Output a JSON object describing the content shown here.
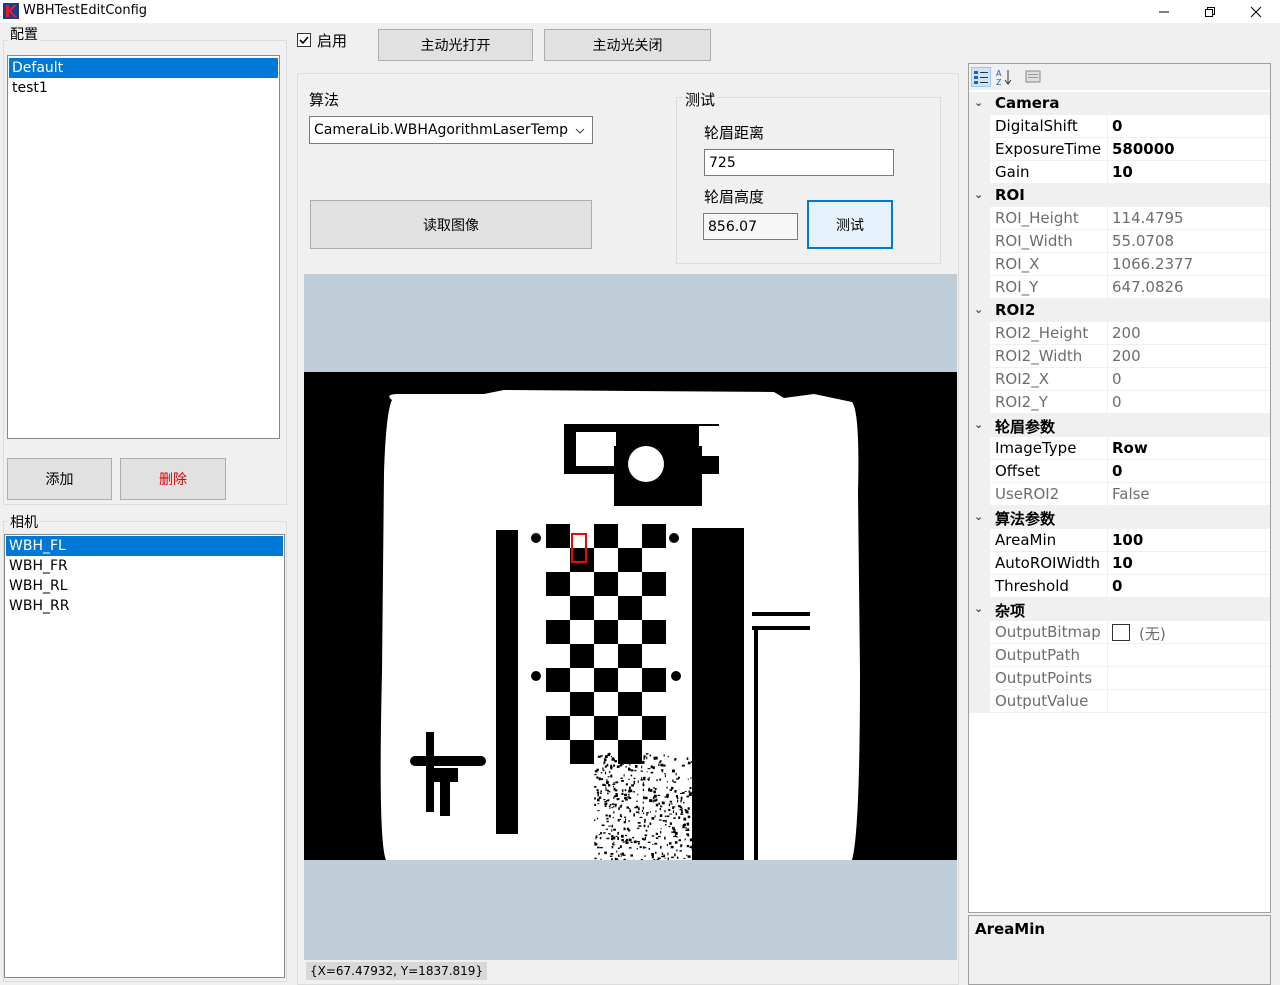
{
  "window": {
    "title": "WBHTestEditConfig"
  },
  "config_group": {
    "title": "配置",
    "items": [
      "Default",
      "test1"
    ],
    "selected": 0
  },
  "buttons": {
    "add": "添加",
    "delete": "删除",
    "light_on": "主动光打开",
    "light_off": "主动光关闭",
    "read_image": "读取图像",
    "test": "测试"
  },
  "enable_checkbox": {
    "label": "启用",
    "checked": true
  },
  "camera_group": {
    "title": "相机",
    "items": [
      "WBH_FL",
      "WBH_FR",
      "WBH_RL",
      "WBH_RR"
    ],
    "selected": 0
  },
  "algorithm": {
    "label": "算法",
    "selected": "CameraLib.WBHAgorithmLaserTemp"
  },
  "test_group": {
    "title": "测试",
    "distance_label": "轮眉距离",
    "distance_value": "725",
    "height_label": "轮眉高度",
    "height_value": "856.07"
  },
  "image_view": {
    "coord_readout": "{X=67.47932, Y=1837.819}"
  },
  "property_grid": {
    "categories": [
      {
        "name": "Camera",
        "props": [
          {
            "name": "DigitalShift",
            "value": "0",
            "readonly": false
          },
          {
            "name": "ExposureTime",
            "value": "580000",
            "readonly": false
          },
          {
            "name": "Gain",
            "value": "10",
            "readonly": false
          }
        ]
      },
      {
        "name": "ROI",
        "props": [
          {
            "name": "ROI_Height",
            "value": "114.4795",
            "readonly": true
          },
          {
            "name": "ROI_Width",
            "value": "55.0708",
            "readonly": true
          },
          {
            "name": "ROI_X",
            "value": "1066.2377",
            "readonly": true
          },
          {
            "name": "ROI_Y",
            "value": "647.0826",
            "readonly": true
          }
        ]
      },
      {
        "name": "ROI2",
        "props": [
          {
            "name": "ROI2_Height",
            "value": "200",
            "readonly": true
          },
          {
            "name": "ROI2_Width",
            "value": "200",
            "readonly": true
          },
          {
            "name": "ROI2_X",
            "value": "0",
            "readonly": true
          },
          {
            "name": "ROI2_Y",
            "value": "0",
            "readonly": true
          }
        ]
      },
      {
        "name": "轮眉参数",
        "props": [
          {
            "name": "ImageType",
            "value": "Row",
            "readonly": false
          },
          {
            "name": "Offset",
            "value": "0",
            "readonly": false
          },
          {
            "name": "UseROI2",
            "value": "False",
            "readonly": true
          }
        ]
      },
      {
        "name": "算法参数",
        "props": [
          {
            "name": "AreaMin",
            "value": "100",
            "readonly": false
          },
          {
            "name": "AutoROIWidth",
            "value": "10",
            "readonly": false
          },
          {
            "name": "Threshold",
            "value": "0",
            "readonly": false
          }
        ]
      },
      {
        "name": "杂项",
        "props": [
          {
            "name": "OutputBitmap",
            "value": "(无)",
            "readonly": true,
            "swatch": true
          },
          {
            "name": "OutputPath",
            "value": "",
            "readonly": true
          },
          {
            "name": "OutputPoints",
            "value": "",
            "readonly": true
          },
          {
            "name": "OutputValue",
            "value": "",
            "readonly": true
          }
        ]
      }
    ],
    "help_title": "AreaMin"
  },
  "colors": {
    "accent": "#0078d7",
    "danger": "#e00000",
    "canvas_bg": "#bfcdd9"
  }
}
